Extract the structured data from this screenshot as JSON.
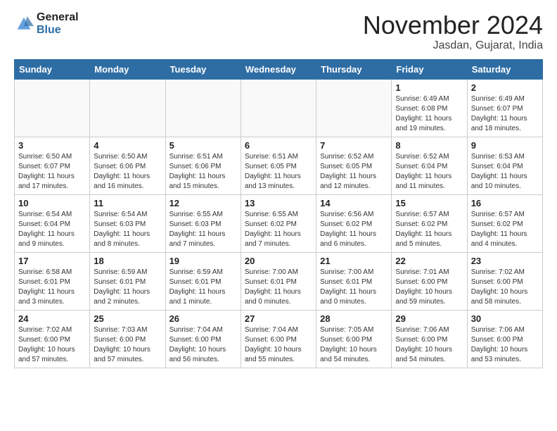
{
  "header": {
    "logo_line1": "General",
    "logo_line2": "Blue",
    "month_title": "November 2024",
    "location": "Jasdan, Gujarat, India"
  },
  "calendar": {
    "days_of_week": [
      "Sunday",
      "Monday",
      "Tuesday",
      "Wednesday",
      "Thursday",
      "Friday",
      "Saturday"
    ],
    "weeks": [
      [
        {
          "day": "",
          "info": ""
        },
        {
          "day": "",
          "info": ""
        },
        {
          "day": "",
          "info": ""
        },
        {
          "day": "",
          "info": ""
        },
        {
          "day": "",
          "info": ""
        },
        {
          "day": "1",
          "info": "Sunrise: 6:49 AM\nSunset: 6:08 PM\nDaylight: 11 hours\nand 19 minutes."
        },
        {
          "day": "2",
          "info": "Sunrise: 6:49 AM\nSunset: 6:07 PM\nDaylight: 11 hours\nand 18 minutes."
        }
      ],
      [
        {
          "day": "3",
          "info": "Sunrise: 6:50 AM\nSunset: 6:07 PM\nDaylight: 11 hours\nand 17 minutes."
        },
        {
          "day": "4",
          "info": "Sunrise: 6:50 AM\nSunset: 6:06 PM\nDaylight: 11 hours\nand 16 minutes."
        },
        {
          "day": "5",
          "info": "Sunrise: 6:51 AM\nSunset: 6:06 PM\nDaylight: 11 hours\nand 15 minutes."
        },
        {
          "day": "6",
          "info": "Sunrise: 6:51 AM\nSunset: 6:05 PM\nDaylight: 11 hours\nand 13 minutes."
        },
        {
          "day": "7",
          "info": "Sunrise: 6:52 AM\nSunset: 6:05 PM\nDaylight: 11 hours\nand 12 minutes."
        },
        {
          "day": "8",
          "info": "Sunrise: 6:52 AM\nSunset: 6:04 PM\nDaylight: 11 hours\nand 11 minutes."
        },
        {
          "day": "9",
          "info": "Sunrise: 6:53 AM\nSunset: 6:04 PM\nDaylight: 11 hours\nand 10 minutes."
        }
      ],
      [
        {
          "day": "10",
          "info": "Sunrise: 6:54 AM\nSunset: 6:04 PM\nDaylight: 11 hours\nand 9 minutes."
        },
        {
          "day": "11",
          "info": "Sunrise: 6:54 AM\nSunset: 6:03 PM\nDaylight: 11 hours\nand 8 minutes."
        },
        {
          "day": "12",
          "info": "Sunrise: 6:55 AM\nSunset: 6:03 PM\nDaylight: 11 hours\nand 7 minutes."
        },
        {
          "day": "13",
          "info": "Sunrise: 6:55 AM\nSunset: 6:02 PM\nDaylight: 11 hours\nand 7 minutes."
        },
        {
          "day": "14",
          "info": "Sunrise: 6:56 AM\nSunset: 6:02 PM\nDaylight: 11 hours\nand 6 minutes."
        },
        {
          "day": "15",
          "info": "Sunrise: 6:57 AM\nSunset: 6:02 PM\nDaylight: 11 hours\nand 5 minutes."
        },
        {
          "day": "16",
          "info": "Sunrise: 6:57 AM\nSunset: 6:02 PM\nDaylight: 11 hours\nand 4 minutes."
        }
      ],
      [
        {
          "day": "17",
          "info": "Sunrise: 6:58 AM\nSunset: 6:01 PM\nDaylight: 11 hours\nand 3 minutes."
        },
        {
          "day": "18",
          "info": "Sunrise: 6:59 AM\nSunset: 6:01 PM\nDaylight: 11 hours\nand 2 minutes."
        },
        {
          "day": "19",
          "info": "Sunrise: 6:59 AM\nSunset: 6:01 PM\nDaylight: 11 hours\nand 1 minute."
        },
        {
          "day": "20",
          "info": "Sunrise: 7:00 AM\nSunset: 6:01 PM\nDaylight: 11 hours\nand 0 minutes."
        },
        {
          "day": "21",
          "info": "Sunrise: 7:00 AM\nSunset: 6:01 PM\nDaylight: 11 hours\nand 0 minutes."
        },
        {
          "day": "22",
          "info": "Sunrise: 7:01 AM\nSunset: 6:00 PM\nDaylight: 10 hours\nand 59 minutes."
        },
        {
          "day": "23",
          "info": "Sunrise: 7:02 AM\nSunset: 6:00 PM\nDaylight: 10 hours\nand 58 minutes."
        }
      ],
      [
        {
          "day": "24",
          "info": "Sunrise: 7:02 AM\nSunset: 6:00 PM\nDaylight: 10 hours\nand 57 minutes."
        },
        {
          "day": "25",
          "info": "Sunrise: 7:03 AM\nSunset: 6:00 PM\nDaylight: 10 hours\nand 57 minutes."
        },
        {
          "day": "26",
          "info": "Sunrise: 7:04 AM\nSunset: 6:00 PM\nDaylight: 10 hours\nand 56 minutes."
        },
        {
          "day": "27",
          "info": "Sunrise: 7:04 AM\nSunset: 6:00 PM\nDaylight: 10 hours\nand 55 minutes."
        },
        {
          "day": "28",
          "info": "Sunrise: 7:05 AM\nSunset: 6:00 PM\nDaylight: 10 hours\nand 54 minutes."
        },
        {
          "day": "29",
          "info": "Sunrise: 7:06 AM\nSunset: 6:00 PM\nDaylight: 10 hours\nand 54 minutes."
        },
        {
          "day": "30",
          "info": "Sunrise: 7:06 AM\nSunset: 6:00 PM\nDaylight: 10 hours\nand 53 minutes."
        }
      ]
    ]
  }
}
